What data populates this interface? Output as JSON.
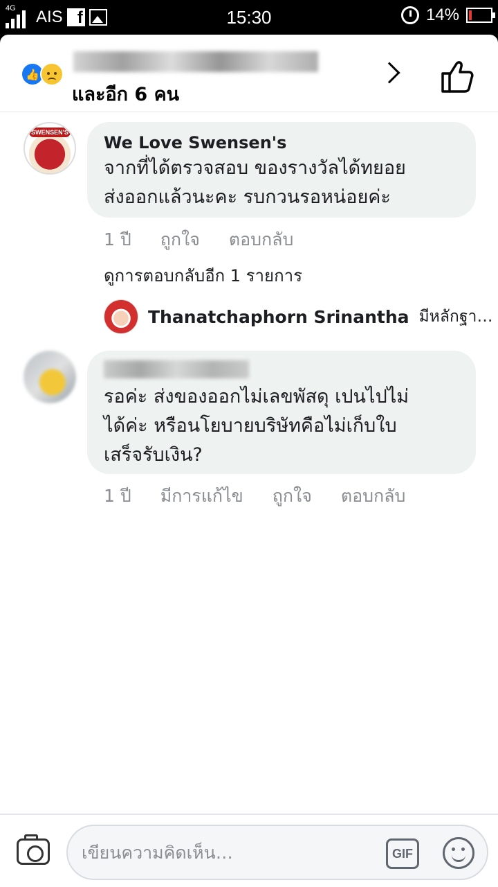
{
  "status_bar": {
    "network_type": "4G",
    "carrier": "AIS",
    "notification_icons": [
      "facebook-icon",
      "image-icon"
    ],
    "time": "15:30",
    "battery_percent": "14%",
    "battery_level": 0.14,
    "alarm_icon": "alarm-icon"
  },
  "reactions_header": {
    "reaction_icons": [
      "like-reaction-icon",
      "sad-reaction-icon"
    ],
    "others_text": "และอีก 6 คน",
    "chevron_icon": "chevron-right-icon",
    "like_icon": "thumbs-up-icon"
  },
  "comments": [
    {
      "author": "We Love Swensen's",
      "avatar_label": "SWENSEN'S",
      "text_line1": "จากที่ได้ตรวจสอบ ของรางวัลได้ทยอย",
      "text_line2": "ส่งออกแล้วนะคะ รบกวนรอหน่อยค่ะ",
      "meta_time": "1 ปี",
      "meta_like": "ถูกใจ",
      "meta_reply": "ตอบกลับ",
      "more_replies": "ดูการตอบกลับอีก 1 รายการ",
      "reply_preview": {
        "author": "Thanatchaphorn Srinantha",
        "snippet": "มีหลักฐา…"
      }
    },
    {
      "text_line1": "รอค่ะ ส่งของออกไม่เลขพัสดุ เปนไปไม่",
      "text_line2": "ได้ค่ะ หรือนโยบายบริษัทคือไม่เก็บใบ",
      "text_line3": "เสร็จรับเงิน?",
      "meta_time": "1 ปี",
      "meta_edited": "มีการแก้ไข",
      "meta_like": "ถูกใจ",
      "meta_reply": "ตอบกลับ"
    }
  ],
  "composer": {
    "camera_icon": "camera-icon",
    "placeholder": "เขียนความคิดเห็น…",
    "gif_label": "GIF",
    "emoji_icon": "emoji-icon"
  },
  "colors": {
    "bubble": "#eef2f1",
    "meta_text": "#8a8d91",
    "facebook_blue": "#1877f2",
    "battery_low": "#e53935"
  }
}
